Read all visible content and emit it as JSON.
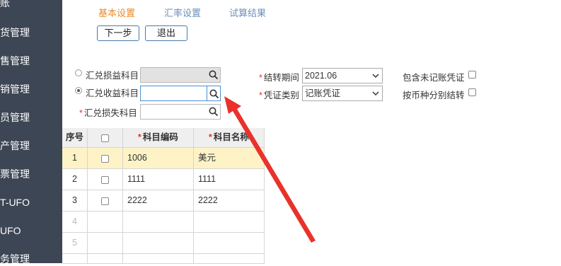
{
  "sidebar": {
    "items": [
      {
        "label": "账"
      },
      {
        "label": "货管理"
      },
      {
        "label": "售管理"
      },
      {
        "label": "销管理"
      },
      {
        "label": "员管理"
      },
      {
        "label": "产管理"
      },
      {
        "label": "票管理"
      },
      {
        "label": "T-UFO"
      },
      {
        "label": "UFO"
      },
      {
        "label": "务管理"
      }
    ]
  },
  "tabs": [
    {
      "label": "基本设置",
      "active": true
    },
    {
      "label": "汇率设置",
      "active": false
    },
    {
      "label": "试算结果",
      "active": false
    }
  ],
  "toolbar": {
    "next_label": "下一步",
    "exit_label": "退出"
  },
  "form": {
    "exchange_pl_label": "汇兑损益科目",
    "exchange_gain_label": "汇兑收益科目",
    "exchange_loss_label": "汇兑损失科目",
    "period_label": "结转期间",
    "period_value": "2021.06",
    "voucher_type_label": "凭证类别",
    "voucher_type_value": "记账凭证",
    "include_unposted_label": "包含未记账凭证",
    "by_currency_label": "按币种分别结转",
    "required_mark": "*"
  },
  "table": {
    "headers": {
      "seq": "序号",
      "code": "科目编码",
      "name": "科目名称"
    },
    "rows": [
      {
        "seq": "1",
        "code": "1006",
        "name": "美元",
        "selected": true
      },
      {
        "seq": "2",
        "code": "1111",
        "name": "1111"
      },
      {
        "seq": "3",
        "code": "2222",
        "name": "2222"
      },
      {
        "seq": "4",
        "code": "",
        "name": ""
      },
      {
        "seq": "5",
        "code": "",
        "name": ""
      }
    ]
  },
  "colors": {
    "sidebar": "#3d4654",
    "active_tab": "#e8892c",
    "inactive_tab": "#6b8fb8",
    "selected_row": "#fdf3c7",
    "arrow": "#e8322b"
  }
}
